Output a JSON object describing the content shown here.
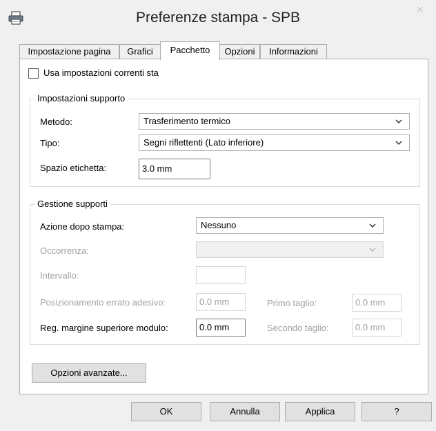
{
  "window": {
    "title": "Preferenze stampa - SPB",
    "close_glyph": "×"
  },
  "tabs": [
    {
      "label": "Impostazione pagina",
      "active": false
    },
    {
      "label": "Grafici",
      "active": false
    },
    {
      "label": "Pacchetto",
      "active": true
    },
    {
      "label": "Opzioni",
      "active": false
    },
    {
      "label": "Informazioni",
      "active": false
    }
  ],
  "use_current_settings": {
    "label": "Usa impostazioni correnti sta",
    "checked": false
  },
  "media_settings": {
    "title": "Impostazioni supporto",
    "method_label": "Metodo:",
    "method_value": "Trasferimento termico",
    "type_label": "Tipo:",
    "type_value": "Segni riflettenti (Lato inferiore)",
    "gap_label": "Spazio etichetta:",
    "gap_value": "3.0 mm"
  },
  "media_handling": {
    "title": "Gestione supporti",
    "post_print_label": "Azione dopo stampa:",
    "post_print_value": "Nessuno",
    "occurrence_label": "Occorrenza:",
    "occurrence_value": "",
    "interval_label": "Intervallo:",
    "interval_value": "",
    "adhesive_label": "Posizionamento errato adesivo:",
    "adhesive_value": "0.0 mm",
    "first_cut_label": "Primo taglio:",
    "first_cut_value": "0.0 mm",
    "top_margin_label": "Reg. margine superiore modulo:",
    "top_margin_value": "0.0 mm",
    "second_cut_label": "Secondo taglio:",
    "second_cut_value": "0.0 mm"
  },
  "advanced_button": "Opzioni avanzate...",
  "buttons": {
    "ok": "OK",
    "cancel": "Annulla",
    "apply": "Applica",
    "help": "?"
  },
  "icons": {
    "app": "printer-icon",
    "dropdown": "chevron-down-icon"
  }
}
